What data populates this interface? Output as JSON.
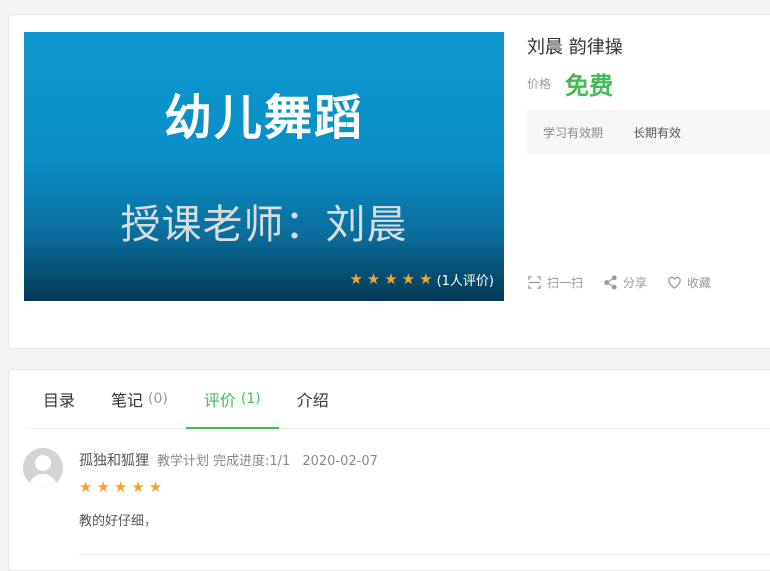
{
  "cover": {
    "title": "幼儿舞蹈",
    "subtitle": "授课老师：刘晨",
    "rating_count": "(1人评价)",
    "stars": 5
  },
  "course": {
    "title": "刘晨 韵律操",
    "price_label": "价格",
    "price_value": "免费",
    "validity_label": "学习有效期",
    "validity_value": "长期有效"
  },
  "actions": {
    "scan": "扫一扫",
    "share": "分享",
    "favorite": "收藏"
  },
  "tabs": [
    {
      "label": "目录",
      "count": ""
    },
    {
      "label": "笔记",
      "count": "(0)"
    },
    {
      "label": "评价",
      "count": "(1)"
    },
    {
      "label": "介绍",
      "count": ""
    }
  ],
  "review": {
    "user": "孤独和狐狸",
    "plan": "教学计划",
    "progress": "完成进度:1/1",
    "date": "2020-02-07",
    "stars": 5,
    "text": "教的好仔细",
    "punct": "，"
  },
  "colors": {
    "accent": "#43bb55",
    "star": "#f7a52a",
    "cover_blue": "#0e97cf"
  }
}
